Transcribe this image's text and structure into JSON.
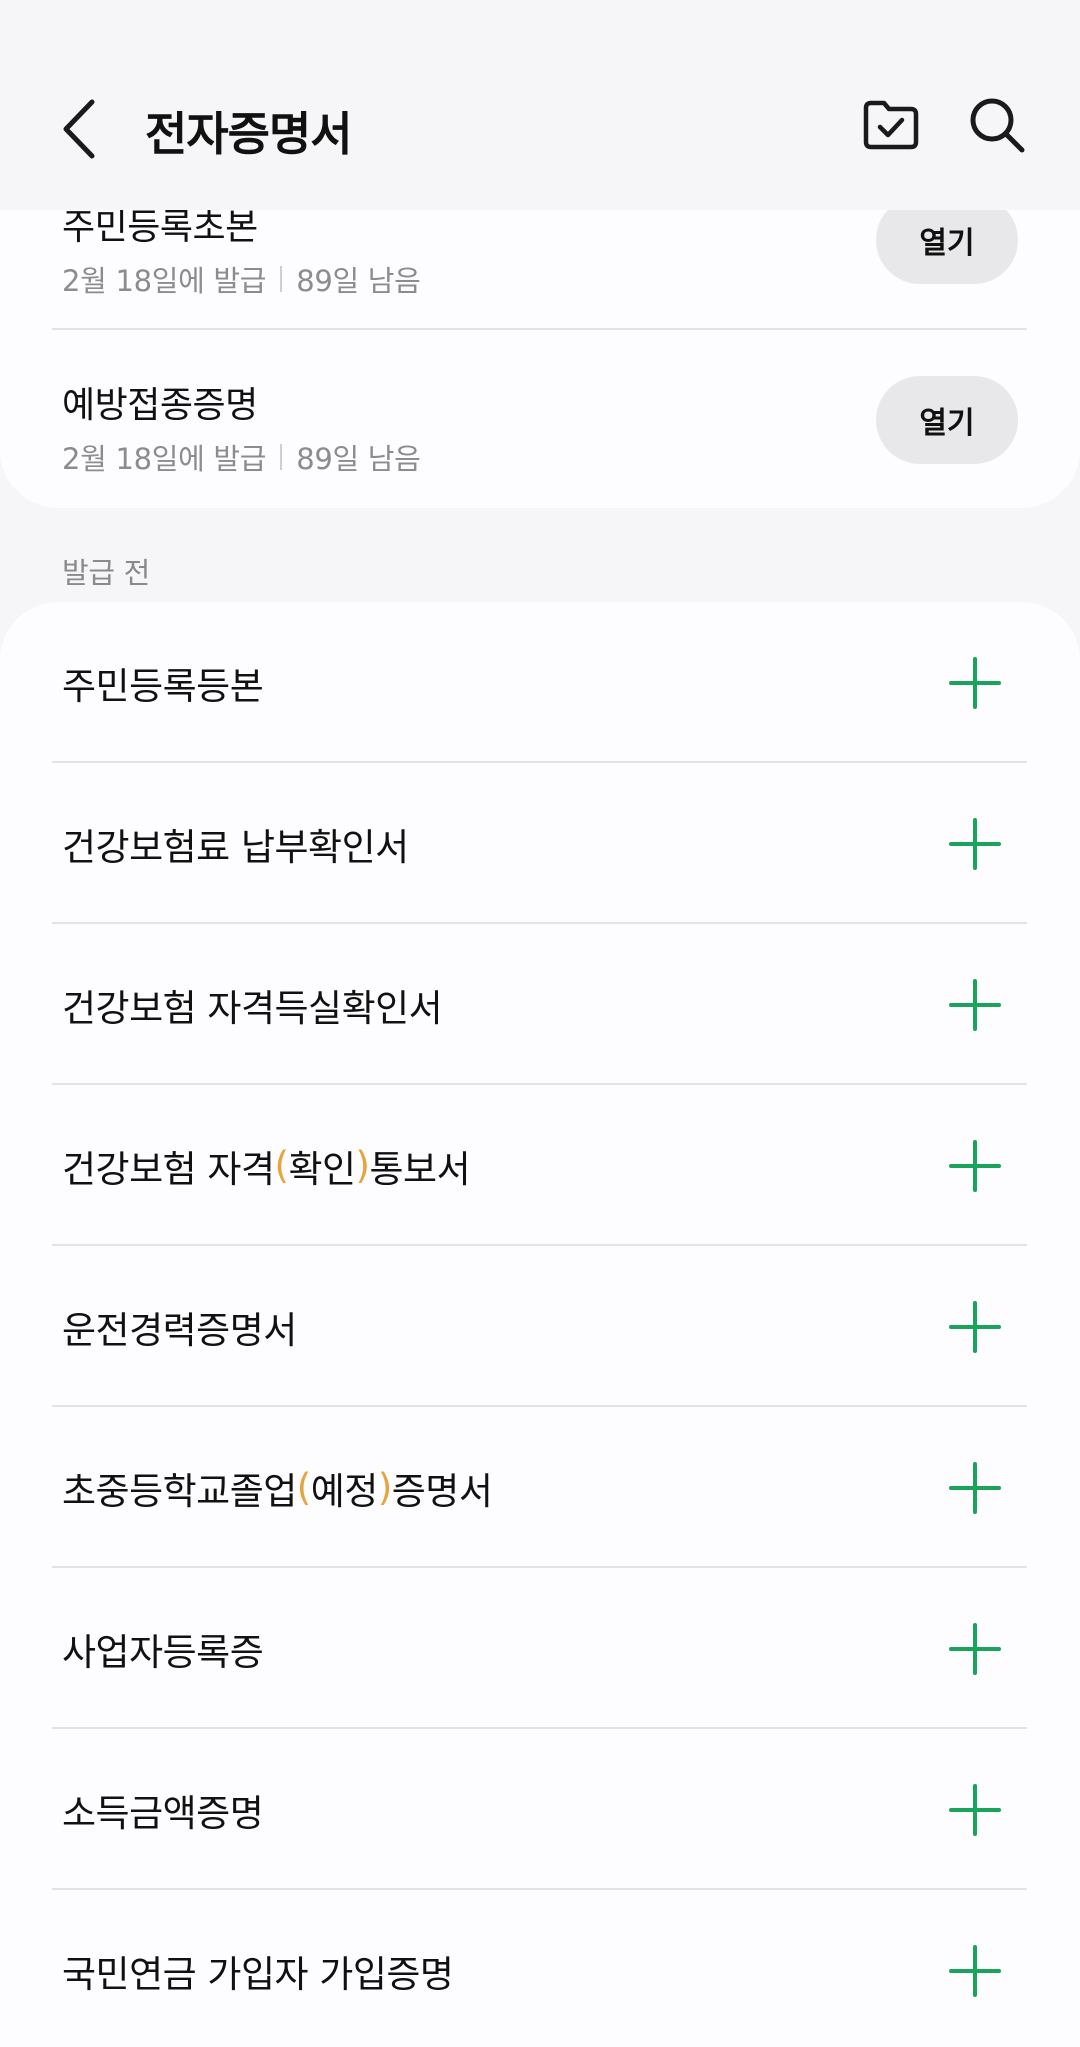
{
  "header": {
    "title": "전자증명서",
    "back_icon": "chevron-left-icon",
    "folder_icon": "folder-check-icon",
    "search_icon": "search-icon"
  },
  "issued": {
    "items": [
      {
        "name": "주민등록초본",
        "issued_date": "2월 18일에 발급",
        "remaining": "89일 남음",
        "open_label": "열기"
      },
      {
        "name": "예방접종증명",
        "issued_date": "2월 18일에 발급",
        "remaining": "89일 남음",
        "open_label": "열기"
      }
    ]
  },
  "pending": {
    "section_label": "발급 전",
    "items": [
      {
        "parts": [
          "주민등록등본"
        ]
      },
      {
        "parts": [
          "건강보험료 납부확인서"
        ]
      },
      {
        "parts": [
          "건강보험 자격득실확인서"
        ]
      },
      {
        "parts": [
          "건강보험 자격",
          "(",
          "확인",
          ")",
          "통보서"
        ]
      },
      {
        "parts": [
          "운전경력증명서"
        ]
      },
      {
        "parts": [
          "초중등학교졸업",
          "(",
          "예정",
          ")",
          "증명서"
        ]
      },
      {
        "parts": [
          "사업자등록증"
        ]
      },
      {
        "parts": [
          "소득금액증명"
        ]
      },
      {
        "parts": [
          "국민연금 가입자 가입증명"
        ]
      }
    ]
  },
  "colors": {
    "accent_green": "#1aa35a",
    "paren_orange": "#e6a43c",
    "open_button_bg": "#e8e8ea"
  }
}
